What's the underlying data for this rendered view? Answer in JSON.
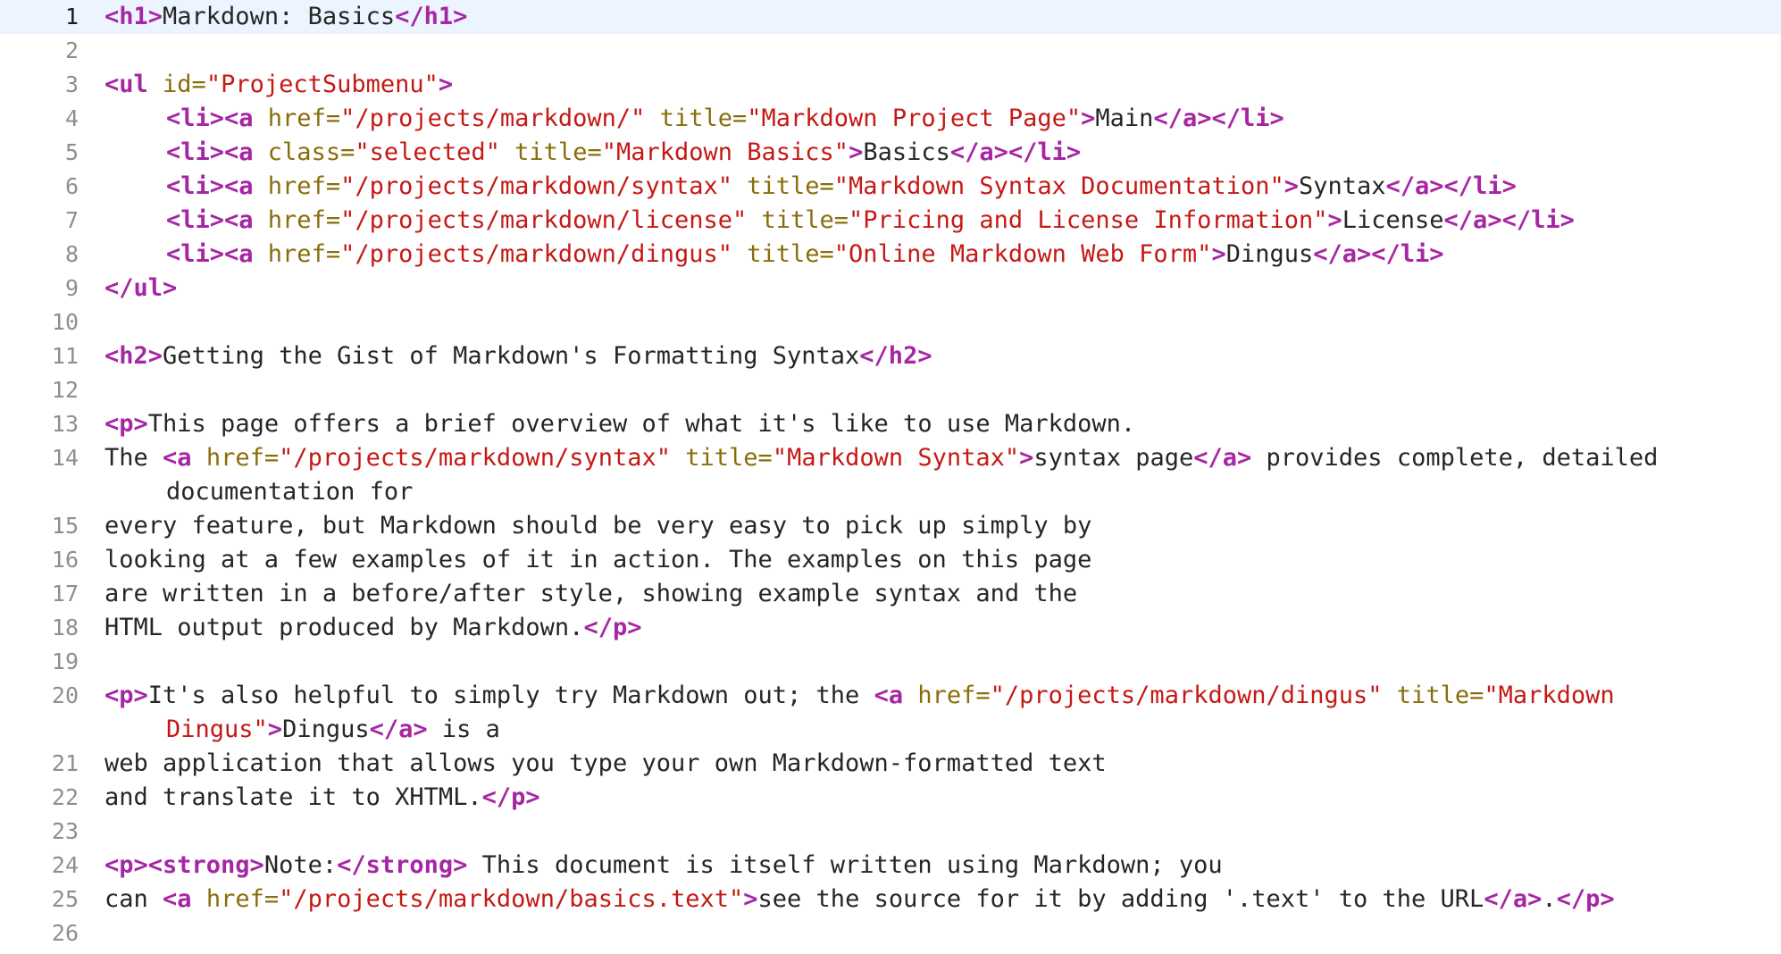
{
  "editor": {
    "current_line": 1,
    "lines": [
      {
        "n": "1",
        "tokens": [
          [
            "t",
            "<h1>"
          ],
          [
            "txt",
            "Markdown: Basics"
          ],
          [
            "t",
            "</h1>"
          ]
        ]
      },
      {
        "n": "2",
        "tokens": []
      },
      {
        "n": "3",
        "tokens": [
          [
            "t",
            "<ul "
          ],
          [
            "at",
            "id="
          ],
          [
            "v",
            "\"ProjectSubmenu\""
          ],
          [
            "t",
            ">"
          ]
        ]
      },
      {
        "n": "4",
        "indent": true,
        "tokens": [
          [
            "t",
            "<li><a "
          ],
          [
            "at",
            "href="
          ],
          [
            "v",
            "\"/projects/markdown/\""
          ],
          [
            "txt",
            " "
          ],
          [
            "at",
            "title="
          ],
          [
            "v",
            "\"Markdown Project Page\""
          ],
          [
            "t",
            ">"
          ],
          [
            "txt",
            "Main"
          ],
          [
            "t",
            "</a></li>"
          ]
        ]
      },
      {
        "n": "5",
        "indent": true,
        "tokens": [
          [
            "t",
            "<li><a "
          ],
          [
            "at",
            "class="
          ],
          [
            "v",
            "\"selected\""
          ],
          [
            "txt",
            " "
          ],
          [
            "at",
            "title="
          ],
          [
            "v",
            "\"Markdown Basics\""
          ],
          [
            "t",
            ">"
          ],
          [
            "txt",
            "Basics"
          ],
          [
            "t",
            "</a></li>"
          ]
        ]
      },
      {
        "n": "6",
        "indent": true,
        "tokens": [
          [
            "t",
            "<li><a "
          ],
          [
            "at",
            "href="
          ],
          [
            "v",
            "\"/projects/markdown/syntax\""
          ],
          [
            "txt",
            " "
          ],
          [
            "at",
            "title="
          ],
          [
            "v",
            "\"Markdown Syntax Documentation\""
          ],
          [
            "t",
            ">"
          ],
          [
            "txt",
            "Syntax"
          ],
          [
            "t",
            "</a></li>"
          ]
        ]
      },
      {
        "n": "7",
        "indent": true,
        "tokens": [
          [
            "t",
            "<li><a "
          ],
          [
            "at",
            "href="
          ],
          [
            "v",
            "\"/projects/markdown/license\""
          ],
          [
            "txt",
            " "
          ],
          [
            "at",
            "title="
          ],
          [
            "v",
            "\"Pricing and License Information\""
          ],
          [
            "t",
            ">"
          ],
          [
            "txt",
            "License"
          ],
          [
            "t",
            "</a></li>"
          ]
        ]
      },
      {
        "n": "8",
        "indent": true,
        "tokens": [
          [
            "t",
            "<li><a "
          ],
          [
            "at",
            "href="
          ],
          [
            "v",
            "\"/projects/markdown/dingus\""
          ],
          [
            "txt",
            " "
          ],
          [
            "at",
            "title="
          ],
          [
            "v",
            "\"Online Markdown Web Form\""
          ],
          [
            "t",
            ">"
          ],
          [
            "txt",
            "Dingus"
          ],
          [
            "t",
            "</a></li>"
          ]
        ]
      },
      {
        "n": "9",
        "tokens": [
          [
            "t",
            "</ul>"
          ]
        ]
      },
      {
        "n": "10",
        "tokens": []
      },
      {
        "n": "11",
        "tokens": [
          [
            "t",
            "<h2>"
          ],
          [
            "txt",
            "Getting the Gist of Markdown's Formatting Syntax"
          ],
          [
            "t",
            "</h2>"
          ]
        ]
      },
      {
        "n": "12",
        "tokens": []
      },
      {
        "n": "13",
        "tokens": [
          [
            "t",
            "<p>"
          ],
          [
            "txt",
            "This page offers a brief overview of what it's like to use Markdown."
          ]
        ]
      },
      {
        "n": "14",
        "wrap": true,
        "tokens": [
          [
            "txt",
            "The "
          ],
          [
            "t",
            "<a "
          ],
          [
            "at",
            "href="
          ],
          [
            "v",
            "\"/projects/markdown/syntax\""
          ],
          [
            "txt",
            " "
          ],
          [
            "at",
            "title="
          ],
          [
            "v",
            "\"Markdown Syntax\""
          ],
          [
            "t",
            ">"
          ],
          [
            "txt",
            "syntax page"
          ],
          [
            "t",
            "</a>"
          ],
          [
            "txt",
            " provides complete, detailed"
          ]
        ],
        "cont": [
          [
            "txt",
            "documentation for"
          ]
        ]
      },
      {
        "n": "15",
        "tokens": [
          [
            "txt",
            "every feature, but Markdown should be very easy to pick up simply by"
          ]
        ]
      },
      {
        "n": "16",
        "tokens": [
          [
            "txt",
            "looking at a few examples of it in action. The examples on this page"
          ]
        ]
      },
      {
        "n": "17",
        "tokens": [
          [
            "txt",
            "are written in a before/after style, showing example syntax and the"
          ]
        ]
      },
      {
        "n": "18",
        "tokens": [
          [
            "txt",
            "HTML output produced by Markdown."
          ],
          [
            "t",
            "</p>"
          ]
        ]
      },
      {
        "n": "19",
        "tokens": []
      },
      {
        "n": "20",
        "wrap": true,
        "tokens": [
          [
            "t",
            "<p>"
          ],
          [
            "txt",
            "It's also helpful to simply try Markdown out; the "
          ],
          [
            "t",
            "<a "
          ],
          [
            "at",
            "href="
          ],
          [
            "v",
            "\"/projects/markdown/dingus\""
          ],
          [
            "txt",
            " "
          ],
          [
            "at",
            "title="
          ],
          [
            "v",
            "\"Markdown"
          ]
        ],
        "cont": [
          [
            "v",
            "Dingus\""
          ],
          [
            "t",
            ">"
          ],
          [
            "txt",
            "Dingus"
          ],
          [
            "t",
            "</a>"
          ],
          [
            "txt",
            " is a"
          ]
        ]
      },
      {
        "n": "21",
        "tokens": [
          [
            "txt",
            "web application that allows you type your own Markdown-formatted text"
          ]
        ]
      },
      {
        "n": "22",
        "tokens": [
          [
            "txt",
            "and translate it to XHTML."
          ],
          [
            "t",
            "</p>"
          ]
        ]
      },
      {
        "n": "23",
        "tokens": []
      },
      {
        "n": "24",
        "tokens": [
          [
            "t",
            "<p><strong>"
          ],
          [
            "txt",
            "Note:"
          ],
          [
            "t",
            "</strong>"
          ],
          [
            "txt",
            " This document is itself written using Markdown; you"
          ]
        ]
      },
      {
        "n": "25",
        "tokens": [
          [
            "txt",
            "can "
          ],
          [
            "t",
            "<a "
          ],
          [
            "at",
            "href="
          ],
          [
            "v",
            "\"/projects/markdown/basics.text\""
          ],
          [
            "t",
            ">"
          ],
          [
            "txt",
            "see the source for it by adding '.text' to the URL"
          ],
          [
            "t",
            "</a>"
          ],
          [
            "txt",
            "."
          ],
          [
            "t",
            "</p>"
          ]
        ]
      },
      {
        "n": "26",
        "tokens": []
      }
    ]
  },
  "colors": {
    "tag": "#a626a4",
    "attribute": "#8a6d0b",
    "value": "#c41a16",
    "text": "#262626",
    "gutter": "#8f8f8f",
    "current_line_bg": "#ecf5ff"
  }
}
